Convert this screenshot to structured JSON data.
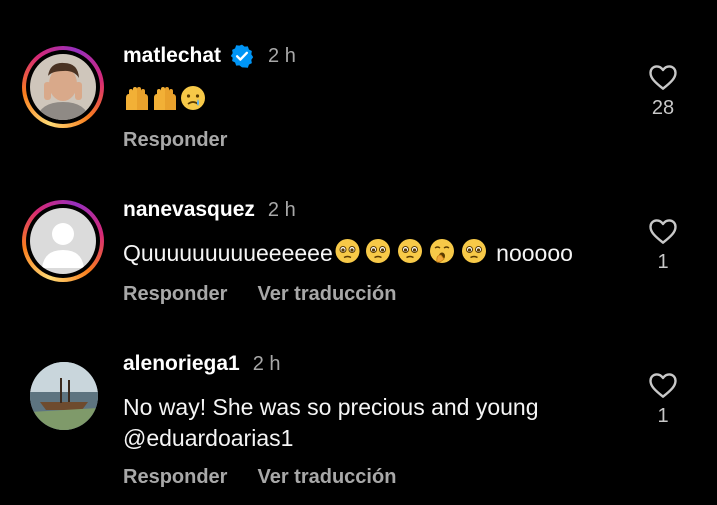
{
  "comments": [
    {
      "username": "matlechat",
      "verified": true,
      "time": "2 h",
      "text": "",
      "emoji": [
        "raising-hands",
        "raising-hands",
        "crying-face"
      ],
      "likes": "28",
      "actions": [
        "Responder"
      ]
    },
    {
      "username": "nanevasquez",
      "verified": false,
      "time": "2 h",
      "text_before": "Quuuuuuuuueeeeee",
      "emoji": [
        "pleading-face",
        "pleading-face",
        "pleading-face",
        "yawning-face",
        "pleading-face"
      ],
      "text_after": " nooooo",
      "likes": "1",
      "actions": [
        "Responder",
        "Ver traducción"
      ]
    },
    {
      "username": "alenoriega1",
      "verified": false,
      "time": "2 h",
      "text_line1": "No way! She was so precious and young",
      "text_line2": "@eduardoarias1",
      "likes": "1",
      "actions": [
        "Responder",
        "Ver traducción"
      ]
    }
  ],
  "colors": {
    "background": "#000000",
    "text": "#f5f5f5",
    "secondary": "#a8a8a8",
    "verified": "#0095f6"
  }
}
